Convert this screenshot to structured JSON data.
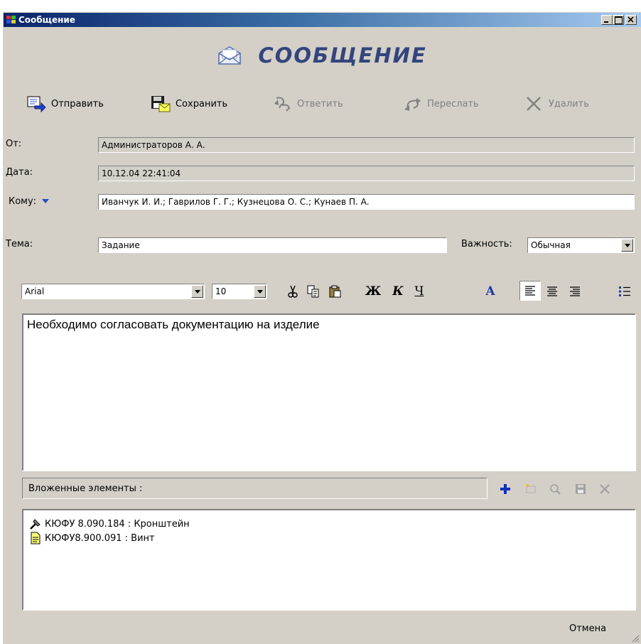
{
  "window": {
    "title": "Сообщение"
  },
  "header": {
    "title": "СООБЩЕНИЕ"
  },
  "toolbar": {
    "send": "Отправить",
    "save": "Сохранить",
    "reply": "Ответить",
    "forward": "Переслать",
    "delete": "Удалить"
  },
  "fields": {
    "from_label": "От:",
    "from_value": "Администраторов А. А.",
    "date_label": "Дата:",
    "date_value": "10.12.04 22:41:04",
    "to_label": "Кому:",
    "to_value": "Иванчук И. И.; Гаврилов Г. Г.; Кузнецова О. С.; Кунаев П. А.",
    "subject_label": "Тема:",
    "subject_value": "Задание",
    "importance_label": "Важность:",
    "importance_value": "Обычная"
  },
  "format": {
    "font": "Arial",
    "size": "10",
    "bold": "Ж",
    "italic": "К",
    "underline": "Ч",
    "color": "A"
  },
  "body": {
    "text": "Необходимо согласовать документацию на изделие"
  },
  "attachments": {
    "header": "Вложенные элементы :",
    "items": [
      {
        "label": "КЮФУ 8.090.184 : Кронштейн",
        "icon": "assembly-icon"
      },
      {
        "label": "КЮФУ8.900.091 : Винт",
        "icon": "document-icon"
      }
    ]
  },
  "footer": {
    "cancel": "Отмена"
  }
}
